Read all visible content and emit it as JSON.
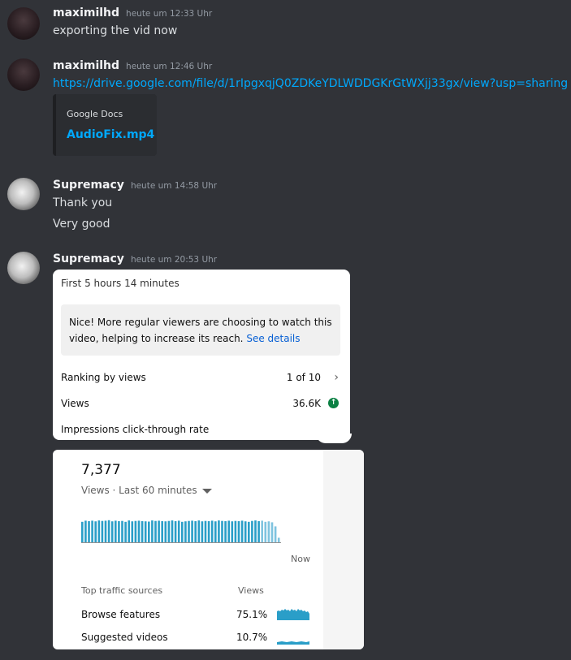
{
  "messages": [
    {
      "username": "maximilhd",
      "time": "heute um 12:33 Uhr",
      "lines": [
        "exporting the vid now"
      ]
    },
    {
      "username": "maximilhd",
      "time": "heute um 12:46 Uhr",
      "link": "https://drive.google.com/file/d/1rIpgxqjQ0ZDKeYDLWDDGKrGtWXjj33gx/view?usp=sharing",
      "embed": {
        "provider": "Google Docs",
        "title": "AudioFix.mp4"
      }
    },
    {
      "username": "Supremacy",
      "time": "heute um 14:58 Uhr",
      "lines": [
        "Thank you",
        "Very good"
      ]
    },
    {
      "username": "Supremacy",
      "time": "heute um 20:53 Uhr"
    }
  ],
  "card1": {
    "period": "First 5 hours 14 minutes",
    "notice": "Nice! More regular viewers are choosing to watch this video, helping to increase its reach.",
    "notice_link": "See details",
    "rows": [
      {
        "label": "Ranking by views",
        "value": "1 of 10",
        "icon": "chevron-right-icon"
      },
      {
        "label": "Views",
        "value": "36.6K",
        "icon": "arrow-up-circle-icon"
      },
      {
        "label": "Impressions click-through rate",
        "value": ""
      }
    ],
    "up_color": "#0b8043"
  },
  "card2": {
    "value": "7,377",
    "views_label": "Views · Last 60 minutes",
    "now_label": "Now",
    "bar_color": "#2a9ec8",
    "bars": [
      0.9,
      0.95,
      0.93,
      0.95,
      0.92,
      0.96,
      0.94,
      0.95,
      0.97,
      0.92,
      0.95,
      0.93,
      0.94,
      0.9,
      0.96,
      0.92,
      0.94,
      0.95,
      0.93,
      0.92,
      0.91,
      0.96,
      0.94,
      0.95,
      0.93,
      0.92,
      0.94,
      0.96,
      0.93,
      0.95,
      0.9,
      0.92,
      0.94,
      0.95,
      0.93,
      0.96,
      0.92,
      0.94,
      0.93,
      0.95,
      0.92,
      0.96,
      0.94,
      0.93,
      0.95,
      0.92,
      0.94,
      0.93,
      0.95,
      0.92,
      0.9,
      0.94,
      0.96,
      0.93,
      0.95,
      0.9,
      0.92,
      0.88,
      0.7,
      0.2
    ],
    "traffic": {
      "header_source": "Top traffic sources",
      "header_views": "Views",
      "rows": [
        {
          "source": "Browse features",
          "pct": "75.1%"
        },
        {
          "source": "Suggested videos",
          "pct": "10.7%"
        }
      ]
    }
  }
}
